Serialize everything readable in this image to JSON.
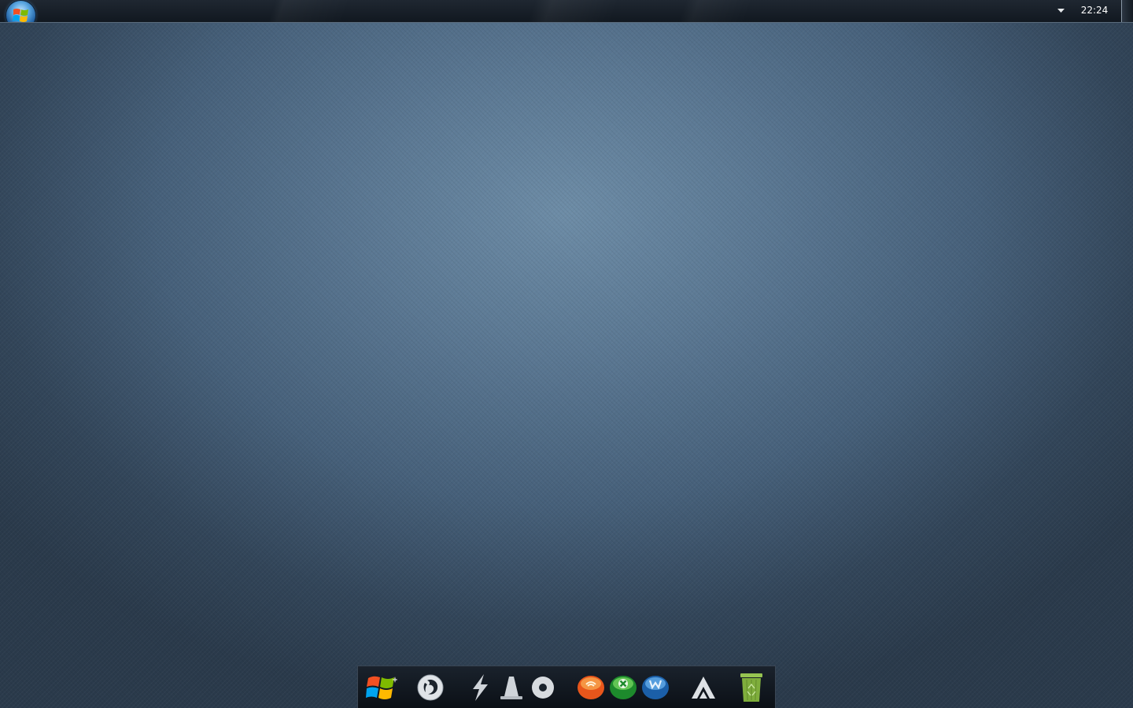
{
  "taskbar": {
    "clock": "22:24",
    "icons": {
      "start": "windows-orb-icon",
      "tray": "chevron-down-icon",
      "show_desktop": "show-desktop-button"
    }
  },
  "dock": {
    "items": [
      {
        "icon": "windows-logo-icon"
      },
      {
        "icon": "firefox-icon"
      },
      {
        "icon": "lightning-icon"
      },
      {
        "icon": "vlc-cone-icon"
      },
      {
        "icon": "disc-icon"
      },
      {
        "icon": "orange-messenger-icon"
      },
      {
        "icon": "xbox-icon"
      },
      {
        "icon": "blue-w-icon"
      },
      {
        "icon": "a-logo-icon"
      },
      {
        "icon": "recycle-bin-icon"
      }
    ]
  },
  "colors": {
    "desktop_center": "#6d8ca6",
    "desktop_edge": "#2a3a4b",
    "taskbar": "#161d26",
    "dock": "#111820",
    "recycle_bin": "#7fae3c"
  }
}
